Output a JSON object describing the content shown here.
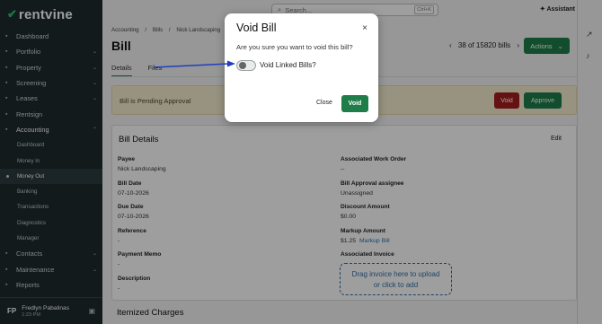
{
  "brand": {
    "name": "rentvine"
  },
  "sidebar": {
    "items": [
      {
        "label": "Dashboard",
        "icon": "home-icon",
        "chev": ""
      },
      {
        "label": "Portfolio",
        "icon": "briefcase-icon",
        "chev": "⌄"
      },
      {
        "label": "Property",
        "icon": "building-icon",
        "chev": "⌄"
      },
      {
        "label": "Screening",
        "icon": "screening-icon",
        "chev": "⌄"
      },
      {
        "label": "Leases",
        "icon": "lease-icon",
        "chev": "⌄"
      },
      {
        "label": "Rentsign",
        "icon": "sign-icon",
        "chev": ""
      },
      {
        "label": "Accounting",
        "icon": "accounting-icon",
        "chev": "⌃"
      }
    ],
    "accounting_sub": [
      "Dashboard",
      "Money In",
      "Money Out",
      "Banking",
      "Transactions",
      "Diagnostics",
      "Manager"
    ],
    "bottom_items": [
      {
        "label": "Contacts",
        "icon": "contacts-icon",
        "chev": "⌄"
      },
      {
        "label": "Maintenance",
        "icon": "wrench-icon",
        "chev": "⌄"
      },
      {
        "label": "Reports",
        "icon": "reports-icon",
        "chev": ""
      }
    ],
    "user": {
      "initials": "FP",
      "name": "Fredlyn Pabalinas",
      "time": "1:23 PM"
    }
  },
  "topbar": {
    "search_placeholder": "Search...",
    "shortcut": "Ctrl+K",
    "assistant": "Assistant"
  },
  "breadcrumbs": [
    "Accounting",
    "/",
    "Bills",
    "/",
    "Nick Landscaping"
  ],
  "page": {
    "title": "Bill",
    "pager": "38 of 15820 bills",
    "actions_label": "Actions",
    "tabs": [
      "Details",
      "Files"
    ],
    "banner": {
      "message": "Bill is Pending Approval",
      "void_label": "Void",
      "approve_label": "Approve"
    }
  },
  "details": {
    "title": "Bill Details",
    "edit_label": "Edit",
    "left": [
      {
        "k": "Payee",
        "v": "Nick Landscaping"
      },
      {
        "k": "Bill Date",
        "v": "07-10-2026"
      },
      {
        "k": "Due Date",
        "v": "07-10-2026"
      },
      {
        "k": "Reference",
        "v": "-"
      },
      {
        "k": "Payment Memo",
        "v": "-"
      },
      {
        "k": "Description",
        "v": "-"
      }
    ],
    "right": [
      {
        "k": "Associated Work Order",
        "v": "--"
      },
      {
        "k": "Bill Approval assignee",
        "v": "Unassigned"
      },
      {
        "k": "Discount Amount",
        "v": "$0.00"
      },
      {
        "k": "Markup Amount",
        "v": "$1.25",
        "link": "Markup Bill"
      },
      {
        "k": "Associated Invoice",
        "v": ""
      }
    ],
    "dropzone": [
      "Drag invoice here to upload",
      "or click to add"
    ]
  },
  "itemized_title": "Itemized Charges",
  "modal": {
    "title": "Void Bill",
    "question": "Are you sure you want to void this bill?",
    "toggle_label": "Void Linked Bills?",
    "toggle_on": false,
    "close_label": "Close",
    "void_label": "Void"
  },
  "colors": {
    "sidebar": "#1f2a2e",
    "primary": "#1e7d49",
    "danger": "#a41e1e",
    "link": "#2f6fa8",
    "arrow": "#1f3fbf"
  }
}
